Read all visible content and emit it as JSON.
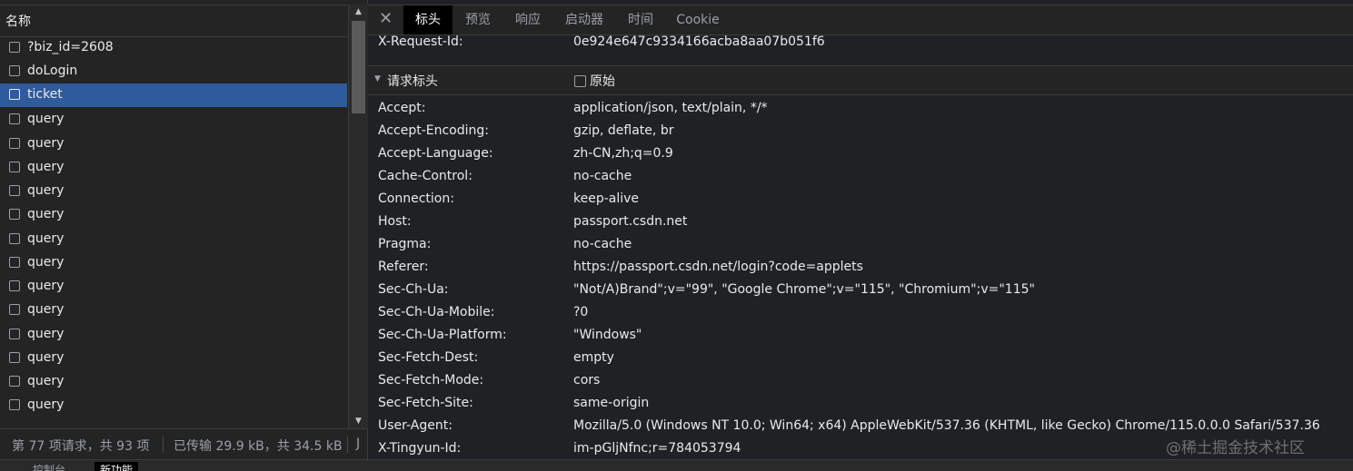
{
  "request_list": {
    "header_label": "名称",
    "items": [
      {
        "name": "?biz_id=2608",
        "selected": false
      },
      {
        "name": "doLogin",
        "selected": false
      },
      {
        "name": "ticket",
        "selected": true
      },
      {
        "name": "query",
        "selected": false
      },
      {
        "name": "query",
        "selected": false
      },
      {
        "name": "query",
        "selected": false
      },
      {
        "name": "query",
        "selected": false
      },
      {
        "name": "query",
        "selected": false
      },
      {
        "name": "query",
        "selected": false
      },
      {
        "name": "query",
        "selected": false
      },
      {
        "name": "query",
        "selected": false
      },
      {
        "name": "query",
        "selected": false
      },
      {
        "name": "query",
        "selected": false
      },
      {
        "name": "query",
        "selected": false
      },
      {
        "name": "query",
        "selected": false
      },
      {
        "name": "query",
        "selected": false
      }
    ]
  },
  "status_bar": {
    "requests": "第 77 项请求，共 93 项",
    "transferred": "已传输 29.9 kB，共 34.5 kB",
    "extra": "J"
  },
  "detail_tabs": {
    "close_icon": "close-icon",
    "items": [
      {
        "label": "标头",
        "active": true
      },
      {
        "label": "预览",
        "active": false
      },
      {
        "label": "响应",
        "active": false
      },
      {
        "label": "启动器",
        "active": false
      },
      {
        "label": "时间",
        "active": false
      },
      {
        "label": "Cookie",
        "active": false
      }
    ]
  },
  "response_header_tail": {
    "key": "X-Request-Id:",
    "value": "0e924e647c9334166acba8aa07b051f6"
  },
  "request_headers_section": {
    "title": "请求标头",
    "raw_label": "原始",
    "raw_checked": false,
    "headers": [
      {
        "key": "Accept:",
        "value": "application/json, text/plain, */*"
      },
      {
        "key": "Accept-Encoding:",
        "value": "gzip, deflate, br"
      },
      {
        "key": "Accept-Language:",
        "value": "zh-CN,zh;q=0.9"
      },
      {
        "key": "Cache-Control:",
        "value": "no-cache"
      },
      {
        "key": "Connection:",
        "value": "keep-alive"
      },
      {
        "key": "Host:",
        "value": "passport.csdn.net"
      },
      {
        "key": "Pragma:",
        "value": "no-cache"
      },
      {
        "key": "Referer:",
        "value": "https://passport.csdn.net/login?code=applets"
      },
      {
        "key": "Sec-Ch-Ua:",
        "value": "\"Not/A)Brand\";v=\"99\", \"Google Chrome\";v=\"115\", \"Chromium\";v=\"115\""
      },
      {
        "key": "Sec-Ch-Ua-Mobile:",
        "value": "?0"
      },
      {
        "key": "Sec-Ch-Ua-Platform:",
        "value": "\"Windows\""
      },
      {
        "key": "Sec-Fetch-Dest:",
        "value": "empty"
      },
      {
        "key": "Sec-Fetch-Mode:",
        "value": "cors"
      },
      {
        "key": "Sec-Fetch-Site:",
        "value": "same-origin"
      },
      {
        "key": "User-Agent:",
        "value": "Mozilla/5.0 (Windows NT 10.0; Win64; x64) AppleWebKit/537.36 (KHTML, like Gecko) Chrome/115.0.0.0 Safari/537.36"
      },
      {
        "key": "X-Tingyun-Id:",
        "value": "im-pGljNfnc;r=784053794"
      }
    ]
  },
  "watermark": "@稀土掘金技术社区",
  "bottom_tabs": [
    {
      "label": "控制台",
      "active": false
    },
    {
      "label": "新功能",
      "active": true
    }
  ],
  "colors": {
    "selected_row": "#2f5a9b",
    "active_tab": "#000000",
    "background": "#202124"
  }
}
